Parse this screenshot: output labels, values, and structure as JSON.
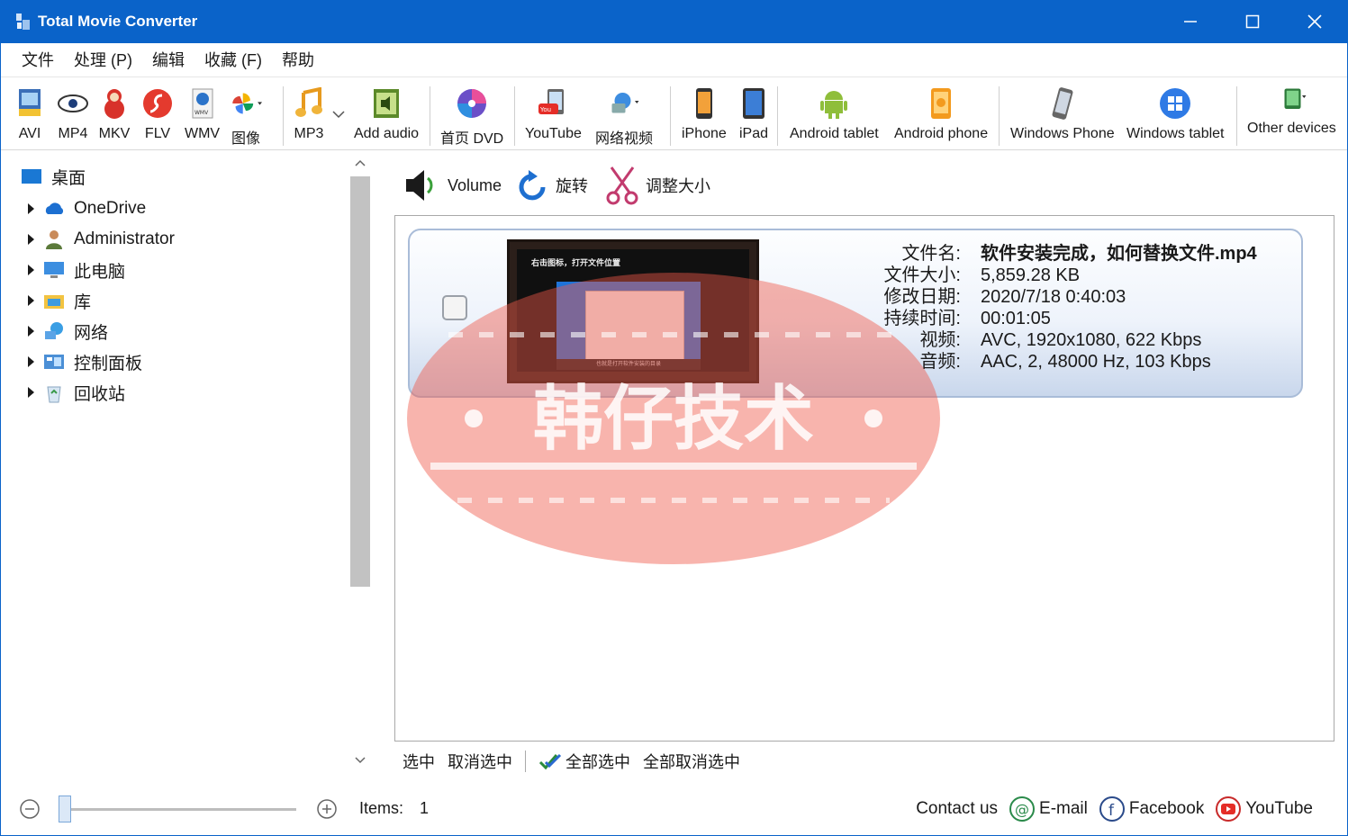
{
  "window": {
    "title": "Total Movie Converter"
  },
  "menu": [
    "文件",
    "处理 (P)",
    "编辑",
    "收藏 (F)",
    "帮助"
  ],
  "toolbar": {
    "avi": "AVI",
    "mp4": "MP4",
    "mkv": "MKV",
    "flv": "FLV",
    "wmv": "WMV",
    "image": "图像",
    "mp3": "MP3",
    "add_audio": "Add audio",
    "dvd": "首页 DVD",
    "youtube": "YouTube",
    "web_video": "网络视频",
    "iphone": "iPhone",
    "ipad": "iPad",
    "android_tablet": "Android tablet",
    "android_phone": "Android phone",
    "windows_phone": "Windows Phone",
    "windows_tablet": "Windows tablet",
    "other_devices": "Other devices"
  },
  "tree": {
    "root": "桌面",
    "items": [
      "OneDrive",
      "Administrator",
      "此电脑",
      "库",
      "网络",
      "控制面板",
      "回收站"
    ]
  },
  "actions": {
    "volume": "Volume",
    "rotate": "旋转",
    "resize": "调整大小"
  },
  "file": {
    "keys": [
      "文件名:",
      "文件大小:",
      "修改日期:",
      "持续时间:",
      "视频:",
      "音频:"
    ],
    "name": "软件安装完成，如何替换文件.mp4",
    "size": "5,859.28 KB",
    "modified": "2020/7/18 0:40:03",
    "duration": "00:01:05",
    "video": "AVC, 1920x1080, 622 Kbps",
    "audio": "AAC, 2, 48000 Hz, 103 Kbps",
    "thumb_caption": "右击图标，打开文件位置",
    "thumb_bar": "也就是打开软件安装的目录"
  },
  "selection": {
    "select": "选中",
    "deselect": "取消选中",
    "select_all": "全部选中",
    "deselect_all": "全部取消选中"
  },
  "status": {
    "items_label": "Items:",
    "items_count": "1",
    "contact": "Contact us",
    "email": "E-mail",
    "facebook": "Facebook",
    "youtube": "YouTube"
  },
  "watermark": {
    "text": "韩仔技术"
  },
  "colors": {
    "titlebar": "#0a63c9",
    "watermark": "#f0584a"
  }
}
